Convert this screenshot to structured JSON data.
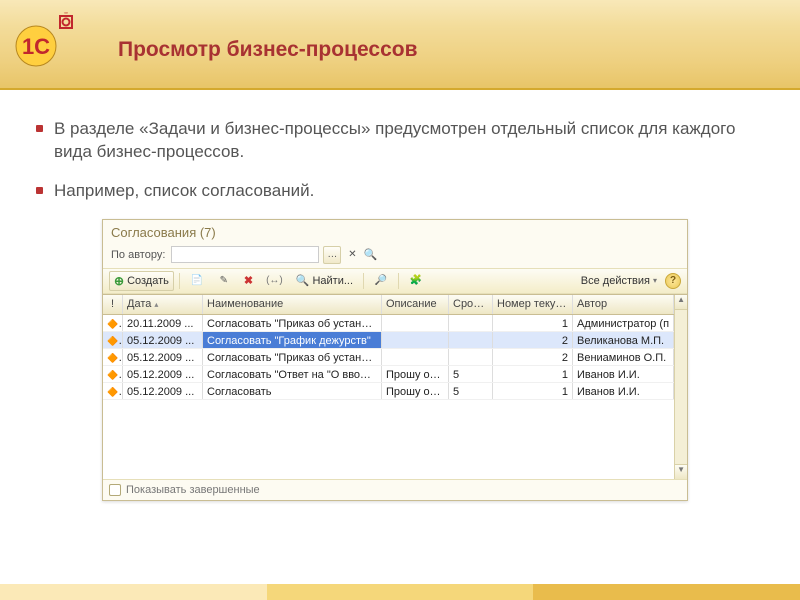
{
  "slide": {
    "title": "Просмотр бизнес-процессов",
    "bullet1": "В разделе «Задачи и бизнес-процессы» предусмотрен отдельный список для каждого вида бизнес-процессов.",
    "bullet2": "Например, список согласований."
  },
  "window": {
    "title": "Согласования (7)",
    "filter_label": "По автору:",
    "toolbar": {
      "create": "Создать",
      "find": "Найти...",
      "all_actions": "Все действия"
    },
    "columns": {
      "flag": "!",
      "date": "Дата",
      "name": "Наименование",
      "desc": "Описание",
      "term": "Срок ...",
      "num": "Номер текущей ...",
      "author": "Автор"
    },
    "rows": [
      {
        "date": "20.11.2009 ...",
        "name": "Согласовать \"Приказ об установлении п...",
        "desc": "",
        "term": "",
        "num": "1",
        "author": "Администратор (п"
      },
      {
        "date": "05.12.2009 ...",
        "name": "Согласовать \"График дежурств\"",
        "desc": "",
        "term": "",
        "num": "2",
        "author": "Великанова М.П."
      },
      {
        "date": "05.12.2009 ...",
        "name": "Согласовать \"Приказ об установлении п...",
        "desc": "",
        "term": "",
        "num": "2",
        "author": "Вениаминов О.П."
      },
      {
        "date": "05.12.2009 ...",
        "name": "Согласовать \"Ответ на \"О вводе в эксп...",
        "desc": "Прошу озна...",
        "term": "5",
        "num": "1",
        "author": "Иванов И.И."
      },
      {
        "date": "05.12.2009 ...",
        "name": "Согласовать",
        "desc": "Прошу озна...",
        "term": "5",
        "num": "1",
        "author": "Иванов И.И."
      }
    ],
    "footer_checkbox": "Показывать завершенные"
  }
}
